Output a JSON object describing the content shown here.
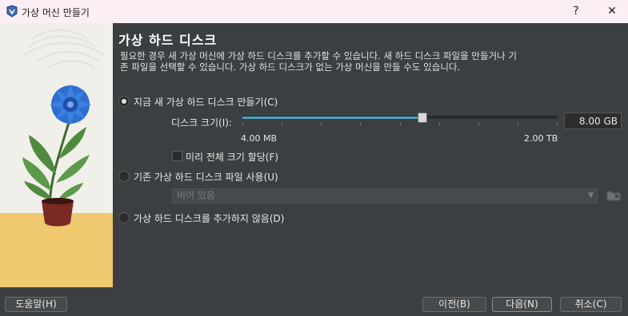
{
  "window": {
    "title": "가상 머신 만들기",
    "help_label": "?",
    "close_label": "✕"
  },
  "main": {
    "heading": "가상 하드 디스크",
    "description": "필요한 경우 새 가상 머신에 가상 하드 디스크를 추가할 수 있습니다. 새 하드 디스크 파일을 만들거나 기존 파일을 선택할 수 있습니다. 가상 하드 디스크가 없는 가상 머신을 만들 수도 있습니다.",
    "options": {
      "create_new": {
        "label": "지금 새 가상 하드 디스크 만들기(C)",
        "selected": true
      },
      "use_existing": {
        "label": "기존 가상 하드 디스크 파일 사용(U)",
        "selected": false
      },
      "no_disk": {
        "label": "가상 하드 디스크를 추가하지 않음(D)",
        "selected": false
      }
    },
    "disk_size": {
      "label": "디스크 크기(I):",
      "value": "8.00 GB",
      "min_label": "4.00 MB",
      "max_label": "2.00 TB",
      "slider_fraction": 0.57
    },
    "preallocate": {
      "label": "미리 전체 크기 할당(F)",
      "checked": false
    },
    "existing_file": {
      "placeholder": "비어 있음"
    }
  },
  "footer": {
    "help_button": "도움말(H)",
    "back_button": "이전(B)",
    "next_button": "다음(N)",
    "cancel_button": "취소(C)"
  },
  "colors": {
    "accent": "#4aa3c8",
    "background": "#3c3f41",
    "titlebar": "#fbeef5",
    "illustration_ground": "#efc870"
  },
  "icons": [
    "app-icon",
    "help-icon",
    "close-icon",
    "chevron-down-icon",
    "folder-icon"
  ]
}
